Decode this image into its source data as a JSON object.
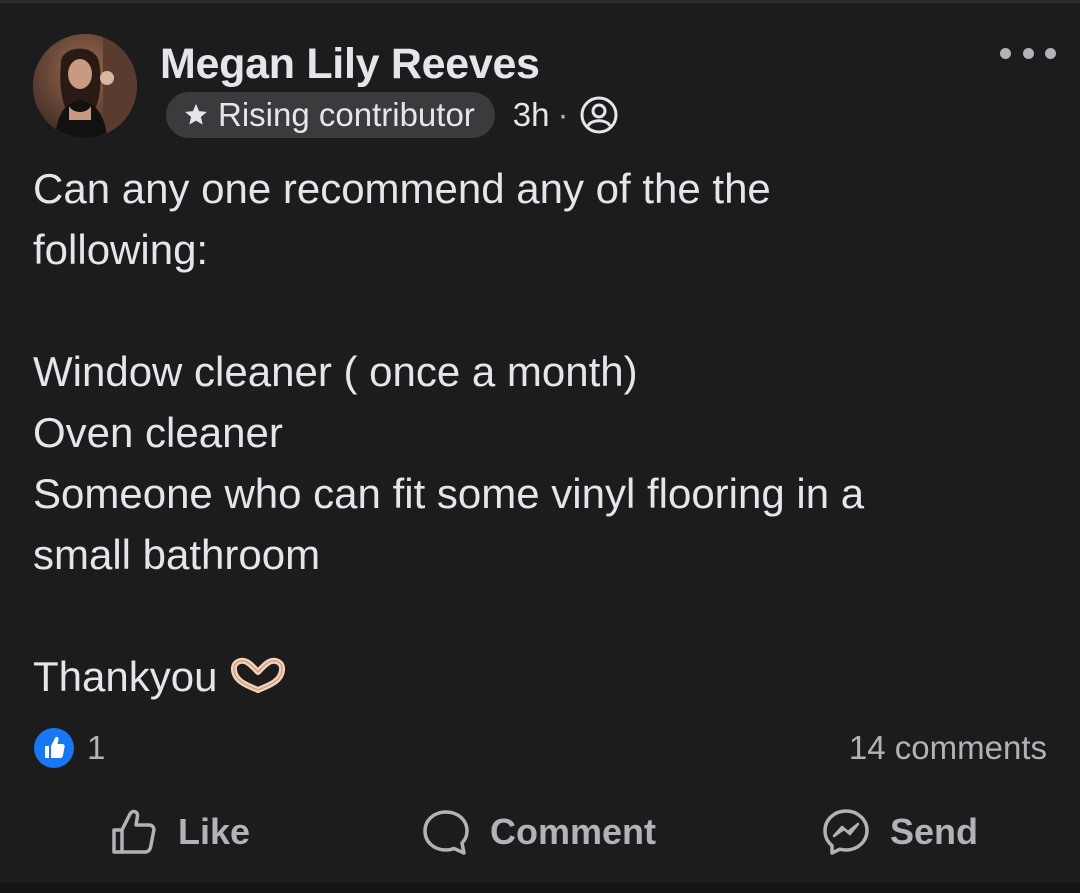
{
  "post": {
    "author": "Megan Lily Reeves",
    "badge": "Rising contributor",
    "time": "3h",
    "separator": "·",
    "text": {
      "line1": "Can any one recommend any of the the",
      "line2": "following:",
      "line3": "Window cleaner ( once a month)",
      "line4": "Oven cleaner",
      "line5": "Someone who can fit some vinyl flooring in a",
      "line6": "small bathroom",
      "line7": "Thankyou"
    },
    "reaction_count": "1",
    "comments_count": "14 comments"
  },
  "actions": {
    "like": "Like",
    "comment": "Comment",
    "send": "Send"
  },
  "icons": {
    "badge": "star-icon",
    "privacy": "group-members-icon",
    "more": "more-options-icon",
    "reaction": "thumbs-up-reaction-icon",
    "emoji": "heart-hands-emoji",
    "like": "thumbs-up-outline-icon",
    "comment": "speech-bubble-icon",
    "send": "messenger-icon"
  },
  "colors": {
    "background": "#1c1c1d",
    "text": "#e4e6eb",
    "secondary_text": "#b0b3b8",
    "badge_background": "#3a3b3c",
    "like_blue": "#1877f2"
  }
}
